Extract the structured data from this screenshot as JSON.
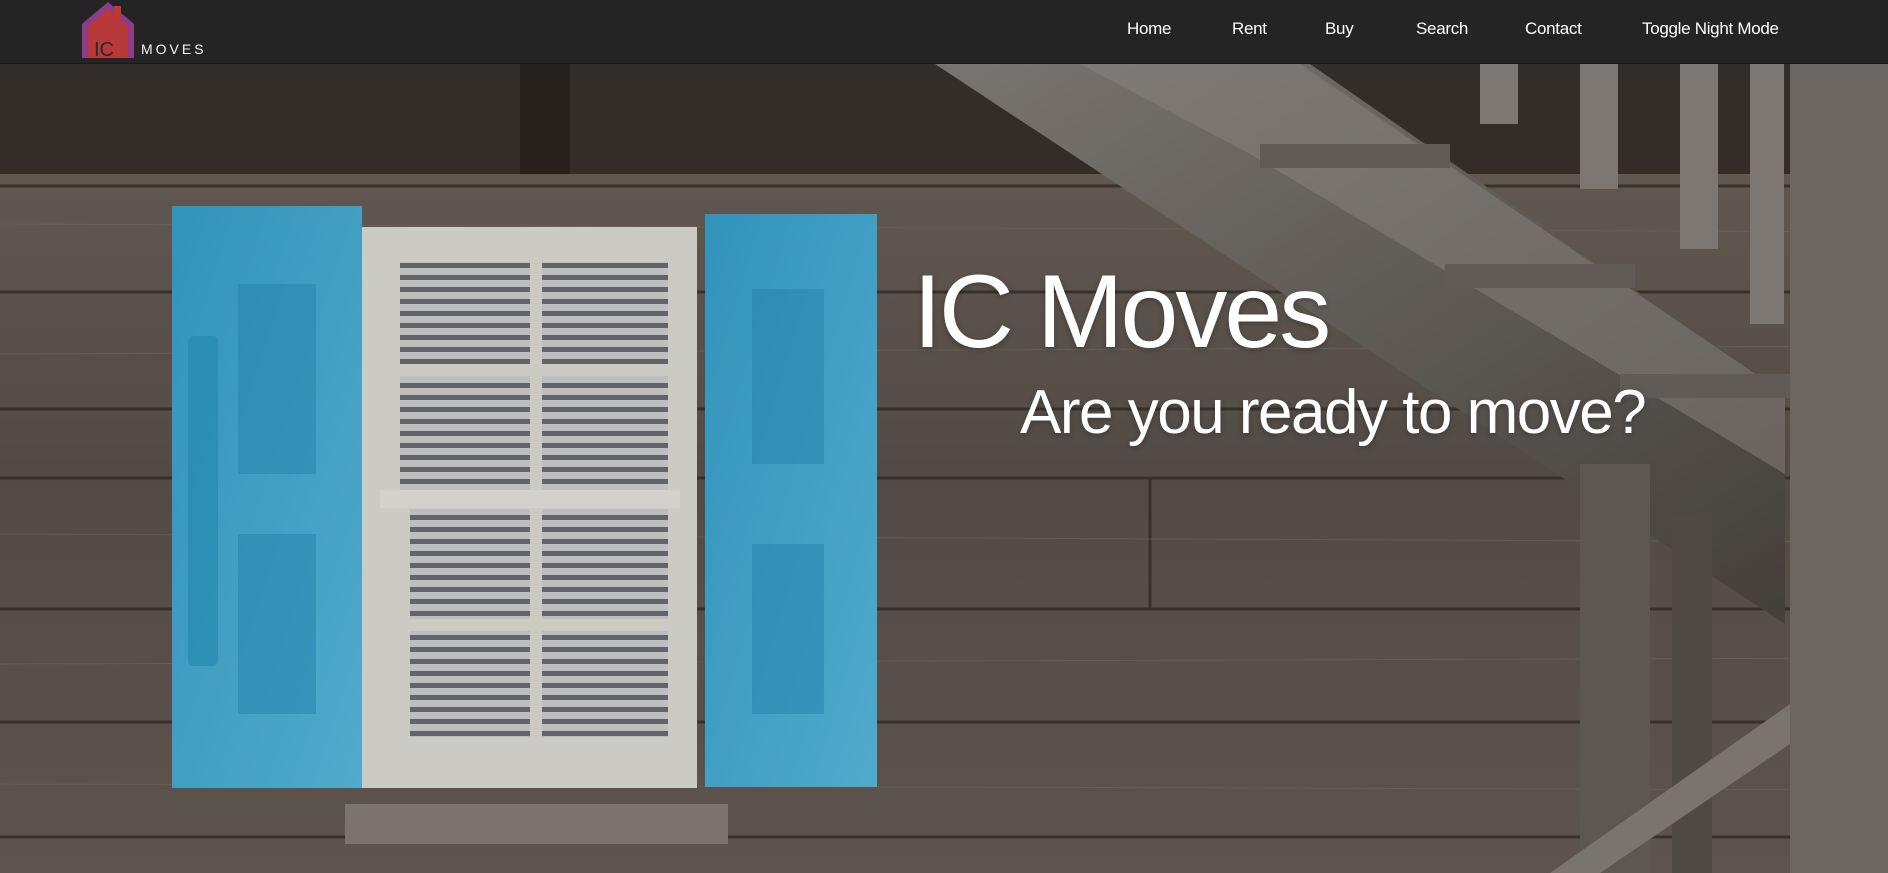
{
  "navbar": {
    "logo": {
      "text": "MOVES",
      "mark_letters": "IC",
      "colors": [
        "#c0392b",
        "#8e3b8a"
      ]
    },
    "links": [
      {
        "label": "Home"
      },
      {
        "label": "Rent"
      },
      {
        "label": "Buy"
      },
      {
        "label": "Search"
      },
      {
        "label": "Contact"
      },
      {
        "label": "Toggle Night Mode"
      }
    ]
  },
  "hero": {
    "title": "IC Moves",
    "subtitle": "Are you ready to move?",
    "background_image": "weathered-wood-house-with-blue-shutters",
    "colors": {
      "wood": "#6b625a",
      "shutter": "#46b3de",
      "window_frame": "#e8e6df",
      "navbar": "#242424"
    }
  }
}
